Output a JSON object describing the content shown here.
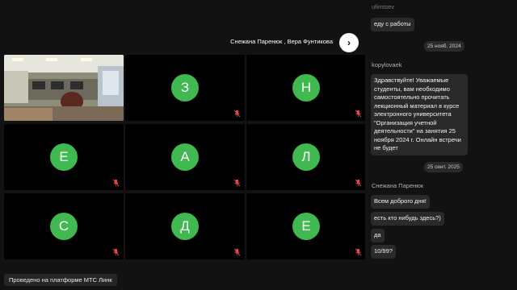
{
  "header": {
    "participants_label": "Снежана Паренюк , Вера Фунтикова",
    "next_icon": "chevron-right-icon"
  },
  "participants": [
    {
      "initial": "",
      "video": true
    },
    {
      "initial": "З"
    },
    {
      "initial": "Н"
    },
    {
      "initial": "Е"
    },
    {
      "initial": "А"
    },
    {
      "initial": "Л"
    },
    {
      "initial": "С"
    },
    {
      "initial": "Д"
    },
    {
      "initial": "Е"
    }
  ],
  "footer": {
    "platform_label": "Проведено на платформе МТС Линк"
  },
  "chat": {
    "top_author": "ufimtsev",
    "top_message": "еду с работы",
    "date1": "25 нояб. 2024",
    "author1": "kopylovaek",
    "message1": "Здравствуйте! Уважаемые студенты, вам необходимо самостоятельно прочитать лекционный материал в курсе электронного университета \"Организация учетной деятельности\" на занятия 25 ноября 2024 г. Онлайн встречи не будет",
    "date2": "25 сент. 2025",
    "author2": "Снежана Паренюк",
    "messages2": [
      "Всем доброго дня!",
      "есть кто нибудь здесь?)",
      "да",
      "10/99?"
    ]
  },
  "colors": {
    "avatar_green": "#3fb950",
    "background": "#121212",
    "mic_off_red": "#e5484d"
  }
}
